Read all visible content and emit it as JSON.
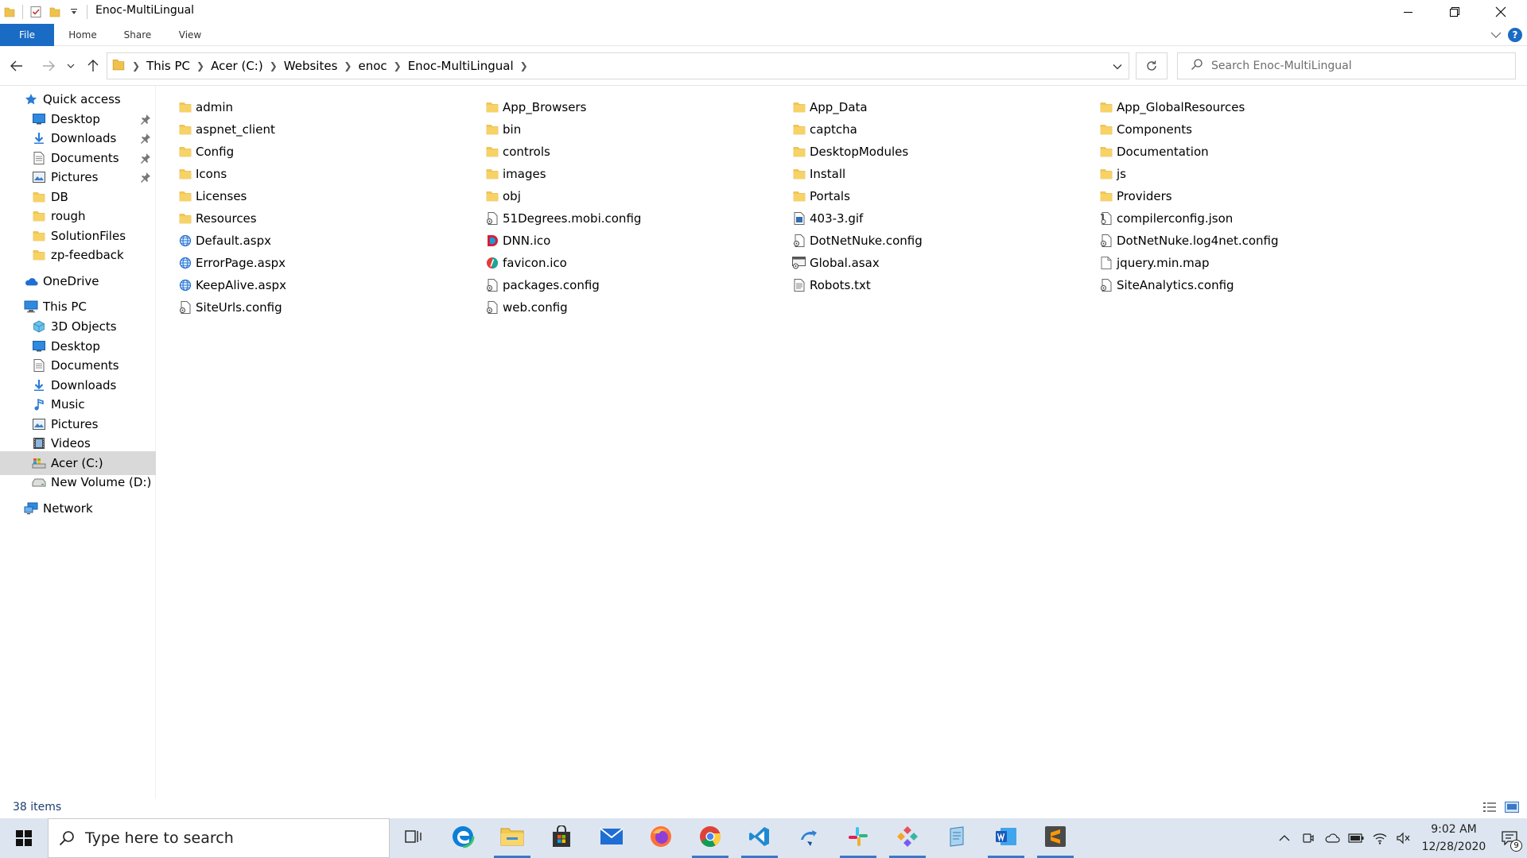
{
  "window": {
    "title": "Enoc-MultiLingual",
    "controls": [
      "minimize-icon",
      "restore-icon",
      "close-icon"
    ]
  },
  "ribbon": {
    "tabs": [
      {
        "label": "File",
        "active": true
      },
      {
        "label": "Home"
      },
      {
        "label": "Share"
      },
      {
        "label": "View"
      }
    ],
    "help_label": "?"
  },
  "address": {
    "breadcrumbs": [
      "This PC",
      "Acer (C:)",
      "Websites",
      "enoc",
      "Enoc-MultiLingual"
    ]
  },
  "search": {
    "placeholder": "Search Enoc-MultiLingual"
  },
  "navpane": {
    "items": [
      {
        "label": "Quick access",
        "icon": "star-icon",
        "level": 0
      },
      {
        "label": "Desktop",
        "icon": "desktop-icon",
        "level": 1,
        "pinned": true
      },
      {
        "label": "Downloads",
        "icon": "downloads-icon",
        "level": 1,
        "pinned": true
      },
      {
        "label": "Documents",
        "icon": "documents-icon",
        "level": 1,
        "pinned": true
      },
      {
        "label": "Pictures",
        "icon": "pictures-icon",
        "level": 1,
        "pinned": true
      },
      {
        "label": "DB",
        "icon": "folder-icon",
        "level": 1
      },
      {
        "label": "rough",
        "icon": "folder-icon",
        "level": 1
      },
      {
        "label": "SolutionFiles",
        "icon": "folder-icon",
        "level": 1
      },
      {
        "label": "zp-feedback",
        "icon": "folder-icon",
        "level": 1
      },
      {
        "label": "OneDrive",
        "icon": "cloud-icon",
        "level": 0
      },
      {
        "label": "This PC",
        "icon": "computer-icon",
        "level": 0
      },
      {
        "label": "3D Objects",
        "icon": "cube-icon",
        "level": 1
      },
      {
        "label": "Desktop",
        "icon": "desktop-icon",
        "level": 1
      },
      {
        "label": "Documents",
        "icon": "documents-icon",
        "level": 1
      },
      {
        "label": "Downloads",
        "icon": "downloads-icon",
        "level": 1
      },
      {
        "label": "Music",
        "icon": "music-icon",
        "level": 1
      },
      {
        "label": "Pictures",
        "icon": "pictures-icon",
        "level": 1
      },
      {
        "label": "Videos",
        "icon": "videos-icon",
        "level": 1
      },
      {
        "label": "Acer (C:)",
        "icon": "drive-c-icon",
        "level": 1,
        "selected": true
      },
      {
        "label": "New Volume (D:)",
        "icon": "drive-icon",
        "level": 1
      },
      {
        "label": "Network",
        "icon": "network-icon",
        "level": 0
      }
    ]
  },
  "files": {
    "columns": [
      [
        {
          "name": "admin",
          "type": "folder"
        },
        {
          "name": "aspnet_client",
          "type": "folder"
        },
        {
          "name": "Config",
          "type": "folder"
        },
        {
          "name": "Icons",
          "type": "folder"
        },
        {
          "name": "Licenses",
          "type": "folder"
        },
        {
          "name": "Resources",
          "type": "folder"
        },
        {
          "name": "Default.aspx",
          "type": "web"
        },
        {
          "name": "ErrorPage.aspx",
          "type": "web"
        },
        {
          "name": "KeepAlive.aspx",
          "type": "web"
        },
        {
          "name": "SiteUrls.config",
          "type": "config"
        }
      ],
      [
        {
          "name": "App_Browsers",
          "type": "folder"
        },
        {
          "name": "bin",
          "type": "folder"
        },
        {
          "name": "controls",
          "type": "folder"
        },
        {
          "name": "images",
          "type": "folder"
        },
        {
          "name": "obj",
          "type": "folder"
        },
        {
          "name": "51Degrees.mobi.config",
          "type": "config"
        },
        {
          "name": "DNN.ico",
          "type": "dnn"
        },
        {
          "name": "favicon.ico",
          "type": "favicon"
        },
        {
          "name": "packages.config",
          "type": "config"
        },
        {
          "name": "web.config",
          "type": "config"
        }
      ],
      [
        {
          "name": "App_Data",
          "type": "folder"
        },
        {
          "name": "captcha",
          "type": "folder"
        },
        {
          "name": "DesktopModules",
          "type": "folder"
        },
        {
          "name": "Install",
          "type": "folder"
        },
        {
          "name": "Portals",
          "type": "folder"
        },
        {
          "name": "403-3.gif",
          "type": "image"
        },
        {
          "name": "DotNetNuke.config",
          "type": "config"
        },
        {
          "name": "Global.asax",
          "type": "asax"
        },
        {
          "name": "Robots.txt",
          "type": "text"
        }
      ],
      [
        {
          "name": "App_GlobalResources",
          "type": "folder"
        },
        {
          "name": "Components",
          "type": "folder"
        },
        {
          "name": "Documentation",
          "type": "folder"
        },
        {
          "name": "js",
          "type": "folder"
        },
        {
          "name": "Providers",
          "type": "folder"
        },
        {
          "name": "compilerconfig.json",
          "type": "json"
        },
        {
          "name": "DotNetNuke.log4net.config",
          "type": "config"
        },
        {
          "name": "jquery.min.map",
          "type": "blank"
        },
        {
          "name": "SiteAnalytics.config",
          "type": "config"
        }
      ]
    ]
  },
  "status": {
    "item_count": "38 items"
  },
  "taskbar": {
    "search_placeholder": "Type here to search",
    "apps": [
      "task-view-icon",
      "edge-icon",
      "file-explorer-icon",
      "store-icon",
      "mail-icon",
      "firefox-icon",
      "chrome-icon",
      "vscode-icon",
      "tortoise-icon",
      "slack-icon",
      "gitkraken-icon",
      "notepad-icon",
      "word-icon",
      "sublime-icon"
    ],
    "active_apps": [
      "file-explorer-icon",
      "chrome-icon",
      "vscode-icon",
      "slack-icon",
      "gitkraken-icon",
      "word-icon",
      "sublime-icon"
    ],
    "time": "9:02 AM",
    "date": "12/28/2020",
    "notification_count": "9"
  },
  "colors": {
    "accent": "#1a6bc4",
    "folder": "#f0c24c",
    "selected": "#d9d9d9",
    "taskbar": "#dde6f0"
  }
}
